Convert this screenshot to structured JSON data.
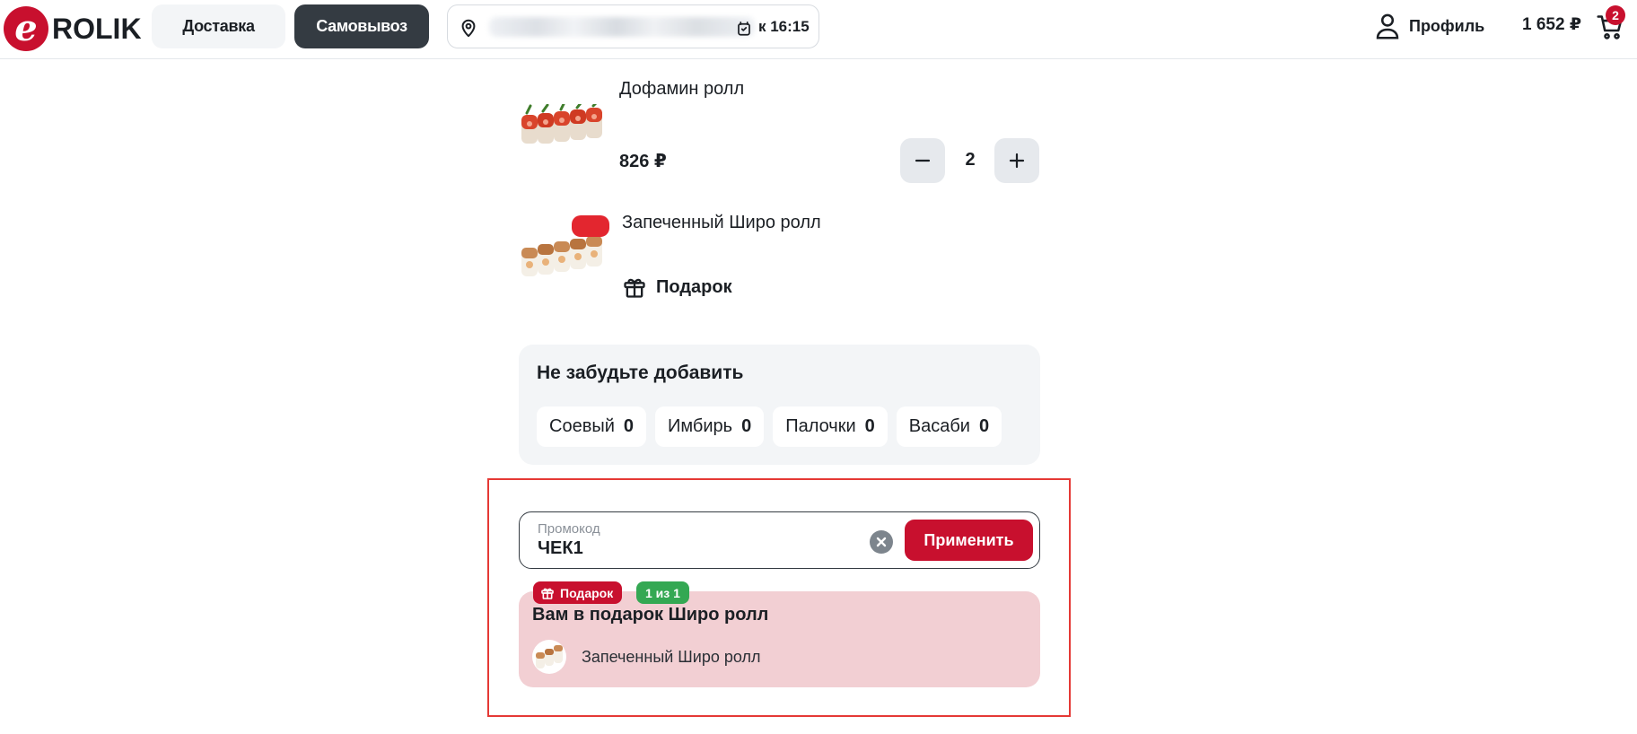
{
  "header": {
    "logo_text": "ROLIK",
    "logo_mark": "e",
    "modes": {
      "delivery": "Доставка",
      "pickup": "Самовывоз",
      "active": "pickup"
    },
    "address": {
      "time": "к 16:15",
      "pin_icon": "map-pin-icon",
      "clock_icon": "alarm-clock-icon"
    },
    "profile_label": "Профиль",
    "cart_total": "1 652 ₽",
    "cart_count": "2"
  },
  "items": [
    {
      "name": "Дофамин ролл",
      "price": "826 ₽",
      "quantity": "2"
    },
    {
      "name": "Запеченный Широ ролл",
      "gift_label": "Подарок"
    }
  ],
  "extras": {
    "title": "Не забудьте добавить",
    "chips": [
      {
        "label": "Соевый",
        "count": "0"
      },
      {
        "label": "Имбирь",
        "count": "0"
      },
      {
        "label": "Палочки",
        "count": "0"
      },
      {
        "label": "Васаби",
        "count": "0"
      }
    ]
  },
  "promo": {
    "label": "Промокод",
    "value": "ЧЕК1",
    "apply_label": "Применить",
    "gift_tag": "Подарок",
    "count_tag": "1 из 1",
    "gift_title": "Вам в подарок Широ ролл",
    "gift_item": "Запеченный Широ ролл"
  },
  "colors": {
    "brand": "#c8102e",
    "dark": "#343b42",
    "success": "#34a853",
    "gift_bg": "#f2cfd3",
    "highlight": "#e53935"
  }
}
